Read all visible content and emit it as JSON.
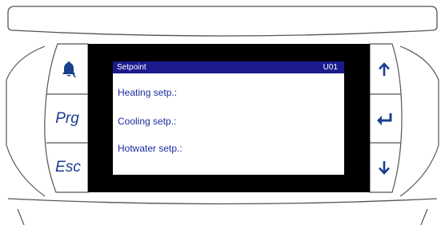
{
  "screen": {
    "title": "Setpoint",
    "code": "U01",
    "items": [
      {
        "label": "Heating setp.:"
      },
      {
        "label": "Cooling setp.:"
      },
      {
        "label": "Hotwater setp.:"
      }
    ]
  },
  "keys": {
    "left": [
      {
        "icon": "bell-icon"
      },
      {
        "label": "Prg"
      },
      {
        "label": "Esc"
      }
    ],
    "right": [
      {
        "icon": "arrow-up-icon"
      },
      {
        "icon": "enter-icon"
      },
      {
        "icon": "arrow-down-icon"
      }
    ]
  },
  "colors": {
    "key_symbol": "#1a3f8f",
    "lcd_titlebar": "#1b1b8e",
    "lcd_text": "#1b2d9a",
    "bezel": "#000000"
  }
}
